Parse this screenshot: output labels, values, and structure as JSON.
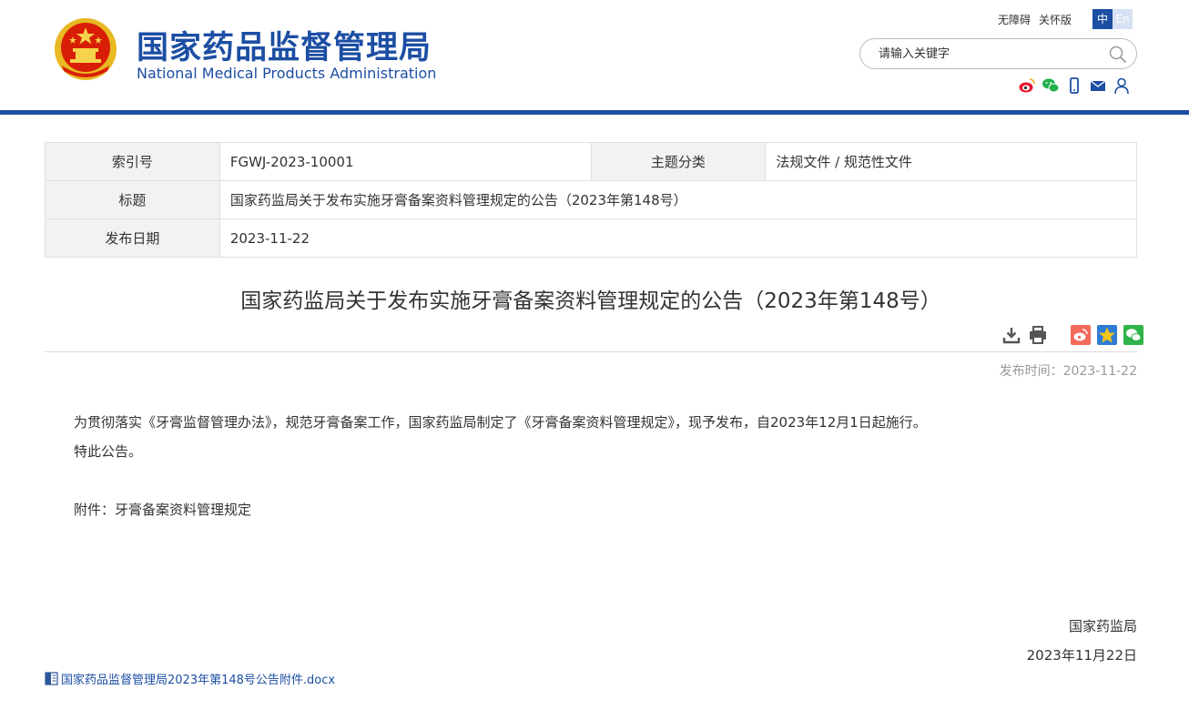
{
  "header": {
    "title_cn": "国家药品监督管理局",
    "title_en": "National Medical Products Administration",
    "top_links": [
      "无障碍",
      "关怀版"
    ],
    "lang_cn": "中",
    "lang_en": "En",
    "search_placeholder": "请输入关键字",
    "colors": {
      "brand": "#1c4ea3"
    }
  },
  "info_table": {
    "index_label": "索引号",
    "index_value": "FGWJ-2023-10001",
    "category_label": "主题分类",
    "category_value": "法规文件 / 规范性文件",
    "title_label": "标题",
    "title_value": "国家药监局关于发布实施牙膏备案资料管理规定的公告（2023年第148号）",
    "date_label": "发布日期",
    "date_value": "2023-11-22"
  },
  "article": {
    "title": "国家药监局关于发布实施牙膏备案资料管理规定的公告（2023年第148号）",
    "publish_label": "发布时间：",
    "publish_date": "2023-11-22",
    "paragraph1": "为贯彻落实《牙膏监督管理办法》，规范牙膏备案工作，国家药监局制定了《牙膏备案资料管理规定》，现予发布，自2023年12月1日起施行。",
    "paragraph2": "特此公告。",
    "attachment_line": "附件：牙膏备案资料管理规定",
    "signer": "国家药监局",
    "sign_date": "2023年11月22日",
    "attachment_file": "国家药品监督管理局2023年第148号公告附件.docx"
  }
}
